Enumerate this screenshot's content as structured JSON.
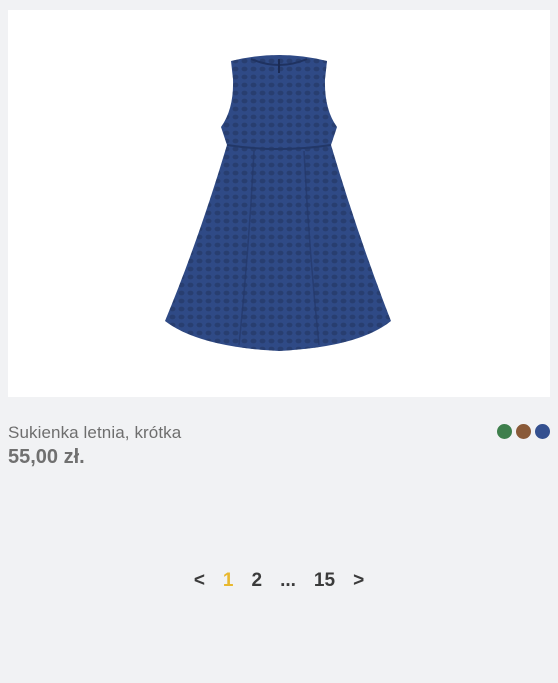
{
  "product": {
    "name": "Sukienka letnia, krótka",
    "price": "55,00 zł.",
    "image_icon": "dress-image",
    "colors": [
      {
        "name": "green-swatch",
        "hex": "#3e7f4c"
      },
      {
        "name": "brown-swatch",
        "hex": "#8a5a38"
      },
      {
        "name": "navy-swatch",
        "hex": "#34508f"
      }
    ]
  },
  "pagination": {
    "prev": "<",
    "pages": [
      "1",
      "2"
    ],
    "ellipsis": "...",
    "last": "15",
    "next": ">",
    "current": "1",
    "active_color": "#e8b82e"
  }
}
